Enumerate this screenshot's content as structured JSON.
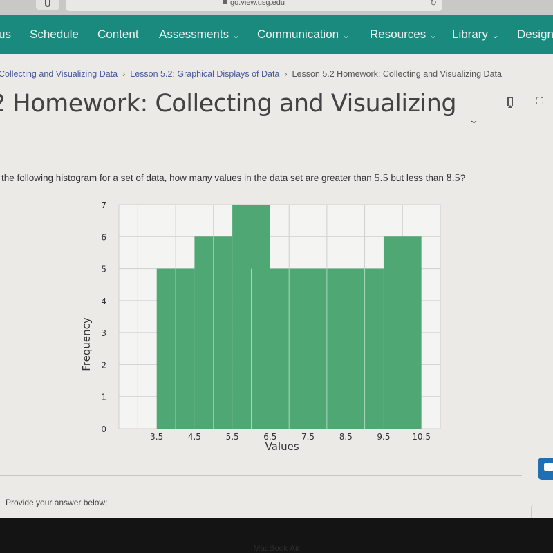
{
  "browser": {
    "url": "go.view.usg.edu"
  },
  "nav": {
    "items": [
      {
        "label": "us",
        "dropdown": false
      },
      {
        "label": "Schedule",
        "dropdown": false
      },
      {
        "label": "Content",
        "dropdown": false
      },
      {
        "label": "Assessments",
        "dropdown": true
      },
      {
        "label": "Communication",
        "dropdown": true
      },
      {
        "label": "Resources",
        "dropdown": true
      },
      {
        "label": "Library",
        "dropdown": true
      },
      {
        "label": "Design",
        "dropdown": false
      }
    ],
    "chevron": "⌄"
  },
  "breadcrumb": {
    "items": [
      "Collecting and Visualizing Data",
      "Lesson 5.2: Graphical Displays of Data",
      "Lesson 5.2 Homework: Collecting and Visualizing Data"
    ],
    "separator": "›"
  },
  "page": {
    "title": "2 Homework: Collecting and Visualizing",
    "title_chevron": "⌄",
    "fullscreen_glyph": "⛶"
  },
  "question": {
    "text_before": "the following histogram for a set of data, how many values in the data set are greater than ",
    "low": "5.5",
    "text_mid": " but less than ",
    "high": "8.5",
    "text_after": "?"
  },
  "answer": {
    "label": "Provide your answer below:"
  },
  "bezel": {
    "text": "MacBook Air"
  },
  "colors": {
    "nav_bg": "#1a8a7e",
    "bar_fill": "#4fa773",
    "link": "#4a5a9a",
    "chat_button": "#1f6fb4"
  },
  "chart_data": {
    "type": "bar",
    "subtype": "histogram",
    "bin_edges": [
      3.5,
      4.5,
      5.5,
      6.5,
      7.5,
      8.5,
      9.5,
      10.5
    ],
    "categories": [
      "3.5–4.5",
      "4.5–5.5",
      "5.5–6.5",
      "6.5–7.5",
      "7.5–8.5",
      "8.5–9.5",
      "9.5–10.5"
    ],
    "values": [
      5,
      6,
      7,
      5,
      5,
      5,
      6
    ],
    "title": "",
    "xlabel": "Values",
    "ylabel": "Frequency",
    "xticks": [
      "3.5",
      "4.5",
      "5.5",
      "6.5",
      "7.5",
      "8.5",
      "9.5",
      "10.5"
    ],
    "yticks": [
      "0",
      "1",
      "2",
      "3",
      "4",
      "5",
      "6",
      "7"
    ],
    "xlim": [
      2.5,
      11
    ],
    "ylim": [
      0,
      7
    ],
    "grid": true
  }
}
